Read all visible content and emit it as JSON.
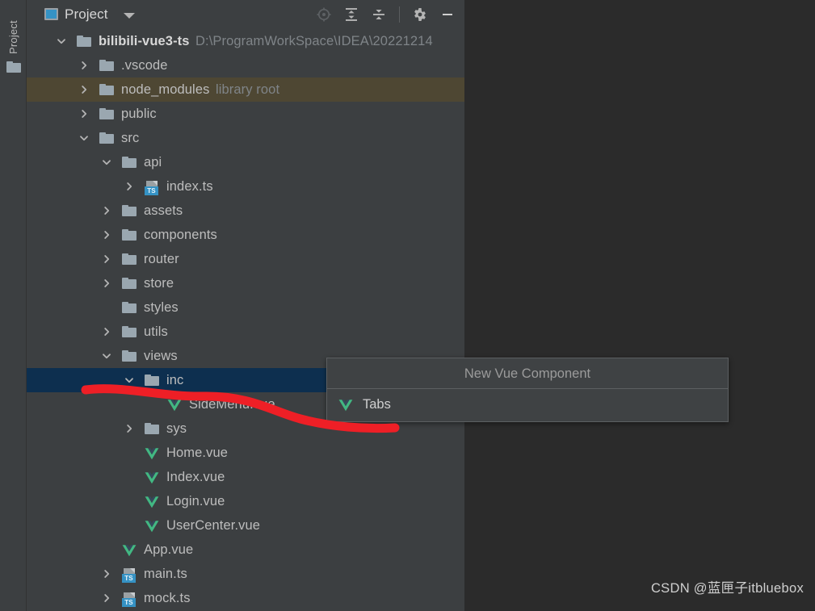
{
  "toolstrip": {
    "label": "Project",
    "icon": "folder-icon"
  },
  "panel_header": {
    "icon": "project-window-icon",
    "title": "Project",
    "caret_icon": "chevron-down-icon",
    "tools": [
      {
        "name": "locate-in-tree-icon",
        "tooltip": "Select Opened File"
      },
      {
        "name": "expand-all-icon",
        "tooltip": "Expand All"
      },
      {
        "name": "collapse-all-icon",
        "tooltip": "Collapse All"
      },
      {
        "name": "settings-gear-icon",
        "tooltip": "Settings"
      },
      {
        "name": "hide-panel-icon",
        "tooltip": "Hide"
      }
    ]
  },
  "tree": {
    "rows": [
      {
        "label": "bilibili-vue3-ts",
        "suffix": "D:\\ProgramWorkSpace\\IDEA\\20221214",
        "icon": "folder-icon",
        "arrow": "chevron-down-icon",
        "depth": 0,
        "bold": true,
        "state": "normal"
      },
      {
        "label": ".vscode",
        "suffix": "",
        "icon": "folder-icon",
        "arrow": "chevron-right-icon",
        "depth": 1,
        "bold": false,
        "state": "normal"
      },
      {
        "label": "node_modules",
        "suffix": "library root",
        "icon": "folder-icon",
        "arrow": "chevron-right-icon",
        "depth": 1,
        "bold": false,
        "state": "library"
      },
      {
        "label": "public",
        "suffix": "",
        "icon": "folder-icon",
        "arrow": "chevron-right-icon",
        "depth": 1,
        "bold": false,
        "state": "normal"
      },
      {
        "label": "src",
        "suffix": "",
        "icon": "folder-icon",
        "arrow": "chevron-down-icon",
        "depth": 1,
        "bold": false,
        "state": "normal"
      },
      {
        "label": "api",
        "suffix": "",
        "icon": "folder-icon",
        "arrow": "chevron-down-icon",
        "depth": 2,
        "bold": false,
        "state": "normal"
      },
      {
        "label": "index.ts",
        "suffix": "",
        "icon": "typescript-file-icon",
        "arrow": "chevron-right-icon",
        "depth": 3,
        "bold": false,
        "state": "normal"
      },
      {
        "label": "assets",
        "suffix": "",
        "icon": "folder-icon",
        "arrow": "chevron-right-icon",
        "depth": 2,
        "bold": false,
        "state": "normal"
      },
      {
        "label": "components",
        "suffix": "",
        "icon": "folder-icon",
        "arrow": "chevron-right-icon",
        "depth": 2,
        "bold": false,
        "state": "normal"
      },
      {
        "label": "router",
        "suffix": "",
        "icon": "folder-icon",
        "arrow": "chevron-right-icon",
        "depth": 2,
        "bold": false,
        "state": "normal"
      },
      {
        "label": "store",
        "suffix": "",
        "icon": "folder-icon",
        "arrow": "chevron-right-icon",
        "depth": 2,
        "bold": false,
        "state": "normal"
      },
      {
        "label": "styles",
        "suffix": "",
        "icon": "folder-icon",
        "arrow": "none",
        "depth": 2,
        "bold": false,
        "state": "normal"
      },
      {
        "label": "utils",
        "suffix": "",
        "icon": "folder-icon",
        "arrow": "chevron-right-icon",
        "depth": 2,
        "bold": false,
        "state": "normal"
      },
      {
        "label": "views",
        "suffix": "",
        "icon": "folder-icon",
        "arrow": "chevron-down-icon",
        "depth": 2,
        "bold": false,
        "state": "normal"
      },
      {
        "label": "inc",
        "suffix": "",
        "icon": "folder-icon",
        "arrow": "chevron-down-icon",
        "depth": 3,
        "bold": false,
        "state": "selected"
      },
      {
        "label": "SideMenu.vue",
        "suffix": "",
        "icon": "vue-file-icon",
        "arrow": "none",
        "depth": 4,
        "bold": false,
        "state": "normal"
      },
      {
        "label": "sys",
        "suffix": "",
        "icon": "folder-icon",
        "arrow": "chevron-right-icon",
        "depth": 3,
        "bold": false,
        "state": "normal"
      },
      {
        "label": "Home.vue",
        "suffix": "",
        "icon": "vue-file-icon",
        "arrow": "none",
        "depth": 3,
        "bold": false,
        "state": "normal"
      },
      {
        "label": "Index.vue",
        "suffix": "",
        "icon": "vue-file-icon",
        "arrow": "none",
        "depth": 3,
        "bold": false,
        "state": "normal"
      },
      {
        "label": "Login.vue",
        "suffix": "",
        "icon": "vue-file-icon",
        "arrow": "none",
        "depth": 3,
        "bold": false,
        "state": "normal"
      },
      {
        "label": "UserCenter.vue",
        "suffix": "",
        "icon": "vue-file-icon",
        "arrow": "none",
        "depth": 3,
        "bold": false,
        "state": "normal"
      },
      {
        "label": "App.vue",
        "suffix": "",
        "icon": "vue-file-icon",
        "arrow": "none",
        "depth": 2,
        "bold": false,
        "state": "normal"
      },
      {
        "label": "main.ts",
        "suffix": "",
        "icon": "typescript-file-icon",
        "arrow": "chevron-right-icon",
        "depth": 2,
        "bold": false,
        "state": "normal"
      },
      {
        "label": "mock.ts",
        "suffix": "",
        "icon": "typescript-file-icon",
        "arrow": "chevron-right-icon",
        "depth": 2,
        "bold": false,
        "state": "normal"
      }
    ]
  },
  "popup": {
    "title": "New Vue Component",
    "items": [
      {
        "label": "Tabs",
        "icon": "vue-file-icon"
      }
    ]
  },
  "annotation": {
    "color": "#ee1f26",
    "shape": "hand-drawn-underline-stroke"
  },
  "watermark": {
    "text": "CSDN @蓝匣子itbluebox"
  },
  "colors": {
    "panel_bg": "#3c3f41",
    "editor_bg": "#2b2b2b",
    "selected_row": "#0d2f4f",
    "library_row": "#4e4733",
    "accent": "#3592c4",
    "vue_green": "#42b883",
    "text": "#bdbdbd",
    "muted_text": "#7f8488"
  }
}
